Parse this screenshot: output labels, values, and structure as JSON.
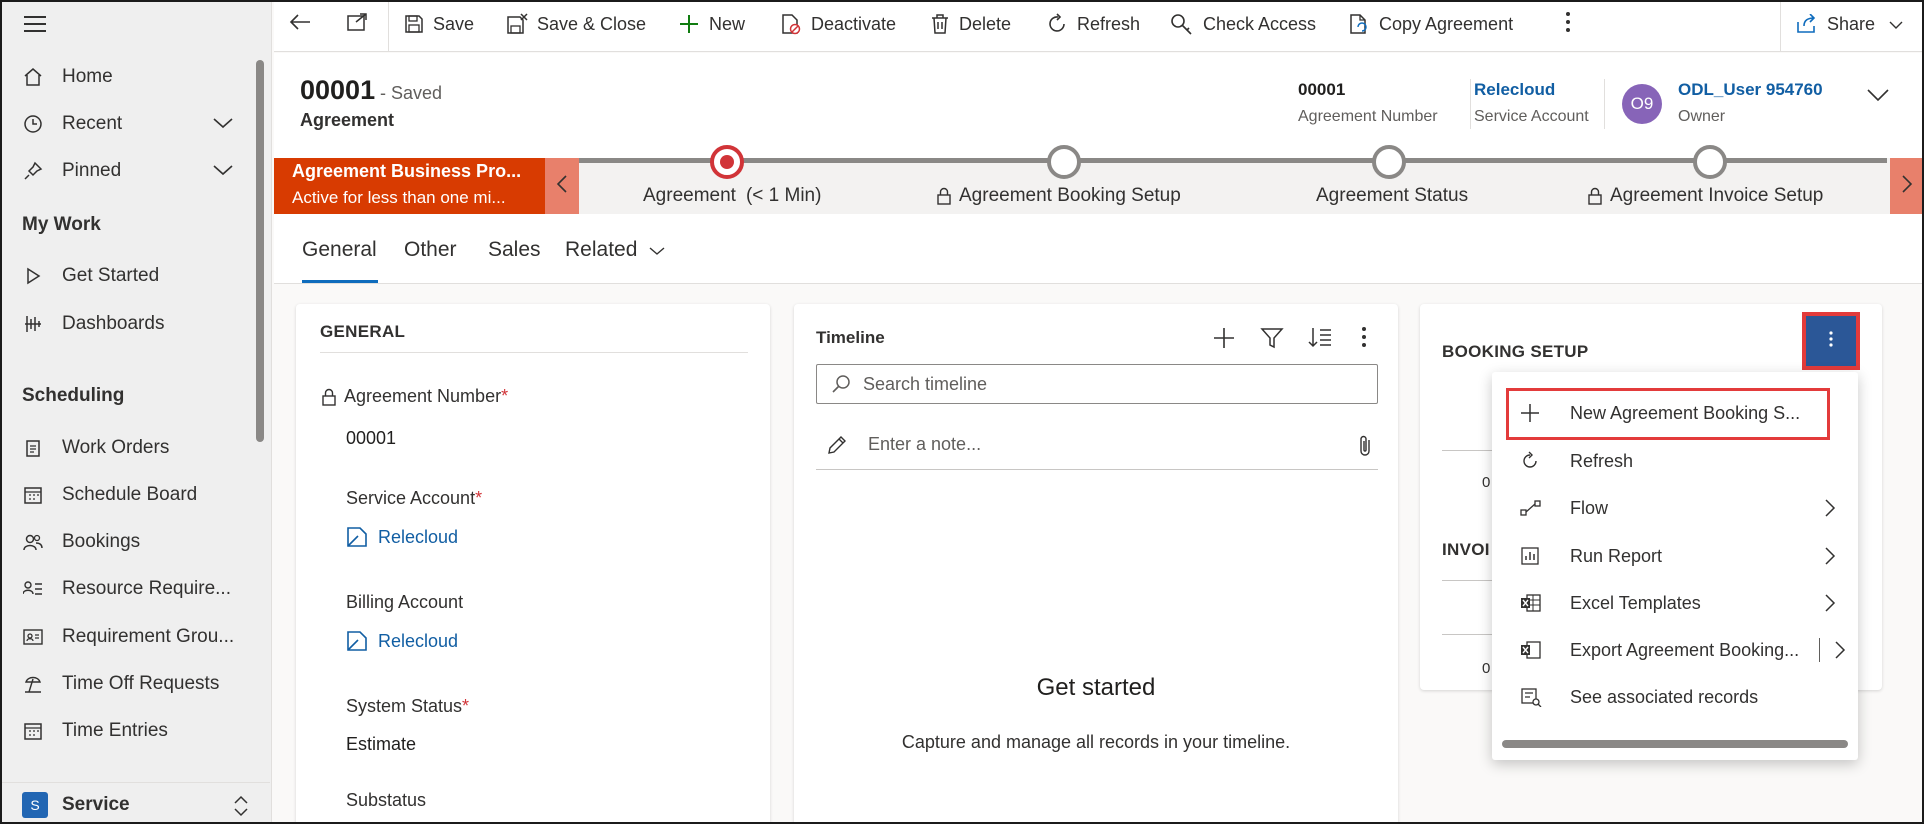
{
  "sidebar": {
    "items": [
      {
        "label": "Home",
        "icon": "home-icon"
      },
      {
        "label": "Recent",
        "icon": "clock-icon"
      },
      {
        "label": "Pinned",
        "icon": "pin-icon"
      }
    ],
    "my_work_title": "My Work",
    "my_work": [
      {
        "label": "Get Started",
        "icon": "play-icon"
      },
      {
        "label": "Dashboards",
        "icon": "dashboard-icon"
      }
    ],
    "scheduling_title": "Scheduling",
    "scheduling": [
      {
        "label": "Work Orders",
        "icon": "clipboard-icon"
      },
      {
        "label": "Schedule Board",
        "icon": "calendar-icon"
      },
      {
        "label": "Bookings",
        "icon": "people-icon"
      },
      {
        "label": "Resource Require...",
        "icon": "list-person-icon"
      },
      {
        "label": "Requirement Grou...",
        "icon": "contact-card-icon"
      },
      {
        "label": "Time Off Requests",
        "icon": "beach-icon"
      },
      {
        "label": "Time Entries",
        "icon": "calendar-icon"
      }
    ],
    "area_badge": "S",
    "area_label": "Service"
  },
  "toolbar": {
    "save": "Save",
    "save_close": "Save & Close",
    "new": "New",
    "deactivate": "Deactivate",
    "delete": "Delete",
    "refresh": "Refresh",
    "check_access": "Check Access",
    "copy_agreement": "Copy Agreement",
    "share": "Share"
  },
  "header": {
    "title": "00001",
    "saved": "- Saved",
    "entity": "Agreement",
    "agreement_number_value": "00001",
    "agreement_number_label": "Agreement Number",
    "service_account_value": "Relecloud",
    "service_account_label": "Service Account",
    "owner_initials": "O9",
    "owner_value": "ODL_User 954760",
    "owner_label": "Owner"
  },
  "bpf": {
    "active_title": "Agreement Business Pro...",
    "active_sub": "Active for less than one mi...",
    "stages": [
      {
        "label": "Agreement",
        "extra": "(< 1 Min)"
      },
      {
        "label": "Agreement Booking Setup"
      },
      {
        "label": "Agreement Status"
      },
      {
        "label": "Agreement Invoice Setup"
      }
    ]
  },
  "tabs": [
    "General",
    "Other",
    "Sales",
    "Related"
  ],
  "general": {
    "title": "GENERAL",
    "agreement_number_label": "Agreement Number",
    "agreement_number_value": "00001",
    "service_account_label": "Service Account",
    "service_account_value": "Relecloud",
    "billing_account_label": "Billing Account",
    "billing_account_value": "Relecloud",
    "system_status_label": "System Status",
    "system_status_value": "Estimate",
    "substatus_label": "Substatus",
    "required_mark": "*"
  },
  "timeline": {
    "title": "Timeline",
    "search_placeholder": "Search timeline",
    "note_placeholder": "Enter a note...",
    "empty_title": "Get started",
    "empty_sub": "Capture and manage all records in your timeline."
  },
  "booking": {
    "title": "BOOKING SETUP",
    "invoice_partial": "INVOI",
    "zero": "0"
  },
  "menu": {
    "items": [
      {
        "label": "New Agreement Booking S...",
        "icon": "plus-icon"
      },
      {
        "label": "Refresh",
        "icon": "refresh-icon"
      },
      {
        "label": "Flow",
        "icon": "flow-icon"
      },
      {
        "label": "Run Report",
        "icon": "report-icon"
      },
      {
        "label": "Excel Templates",
        "icon": "excel-icon"
      },
      {
        "label": "Export Agreement Booking...",
        "icon": "excel-export-icon"
      },
      {
        "label": "See associated records",
        "icon": "associated-records-icon"
      }
    ]
  },
  "colors": {
    "bpf_active": "#d83b01",
    "accent": "#0f6cbd",
    "highlight": "#e33b3b",
    "more_button": "#2b5797"
  }
}
